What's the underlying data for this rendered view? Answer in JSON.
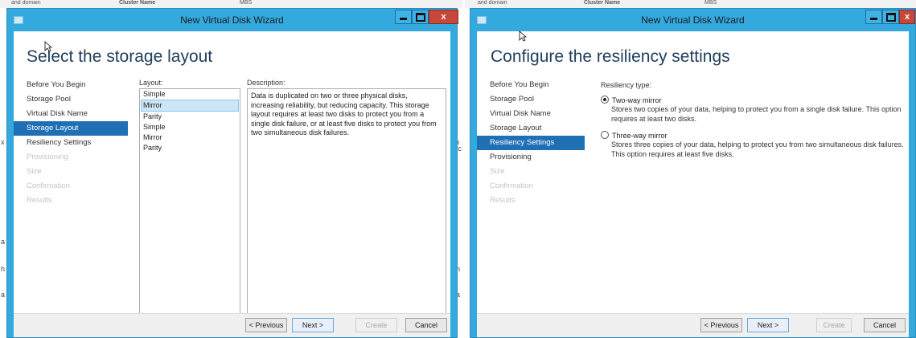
{
  "background": {
    "left_strip": [
      "and domain",
      "Cluster Name",
      "MBS"
    ],
    "right_strip": [
      "and domain",
      "Cluster Name",
      "MBS"
    ],
    "edge_letters_left": [
      "x",
      "a",
      "h",
      "a"
    ],
    "edge_letters_mid": [
      "x",
      "tc",
      "h",
      "a"
    ]
  },
  "windows": [
    {
      "title": "New Virtual Disk Wizard",
      "controls": {
        "minimize": "–",
        "maximize": "□",
        "close": "x"
      },
      "heading": "Select the storage layout",
      "nav": [
        {
          "label": "Before You Begin",
          "state": "normal"
        },
        {
          "label": "Storage Pool",
          "state": "normal"
        },
        {
          "label": "Virtual Disk Name",
          "state": "normal"
        },
        {
          "label": "Storage Layout",
          "state": "active"
        },
        {
          "label": "Resiliency Settings",
          "state": "normal"
        },
        {
          "label": "Provisioning",
          "state": "disabled"
        },
        {
          "label": "Size",
          "state": "disabled"
        },
        {
          "label": "Confirmation",
          "state": "disabled"
        },
        {
          "label": "Results",
          "state": "disabled"
        }
      ],
      "layout_label": "Layout:",
      "layout_items": [
        {
          "label": "Simple",
          "selected": false
        },
        {
          "label": "Mirror",
          "selected": true
        },
        {
          "label": "Parity",
          "selected": false
        },
        {
          "label": "Simple",
          "selected": false
        },
        {
          "label": "Mirror",
          "selected": false
        },
        {
          "label": "Parity",
          "selected": false
        }
      ],
      "description_label": "Description:",
      "description": "Data is duplicated on two or three physical disks, increasing reliability, but reducing capacity. This storage layout requires at least two disks to protect you from a single disk failure, or at least five disks to protect you from two simultaneous disk failures.",
      "buttons": {
        "previous": "< Previous",
        "next": "Next >",
        "create": "Create",
        "cancel": "Cancel"
      }
    },
    {
      "title": "New Virtual Disk Wizard",
      "controls": {
        "minimize": "–",
        "maximize": "□",
        "close": "x"
      },
      "heading": "Configure the resiliency settings",
      "nav": [
        {
          "label": "Before You Begin",
          "state": "normal"
        },
        {
          "label": "Storage Pool",
          "state": "normal"
        },
        {
          "label": "Virtual Disk Name",
          "state": "normal"
        },
        {
          "label": "Storage Layout",
          "state": "normal"
        },
        {
          "label": "Resiliency Settings",
          "state": "active"
        },
        {
          "label": "Provisioning",
          "state": "normal"
        },
        {
          "label": "Size",
          "state": "disabled"
        },
        {
          "label": "Confirmation",
          "state": "disabled"
        },
        {
          "label": "Results",
          "state": "disabled"
        }
      ],
      "resiliency_label": "Resiliency type:",
      "options": [
        {
          "label": "Two-way mirror",
          "checked": true,
          "description": "Stores two copies of your data, helping to protect you from a single disk failure. This option requires at least two disks."
        },
        {
          "label": "Three-way mirror",
          "checked": false,
          "description": "Stores three copies of your data, helping to protect you from two simultaneous disk failures. This option requires at least five disks."
        }
      ],
      "buttons": {
        "previous": "< Previous",
        "next": "Next >",
        "create": "Create",
        "cancel": "Cancel"
      }
    }
  ]
}
